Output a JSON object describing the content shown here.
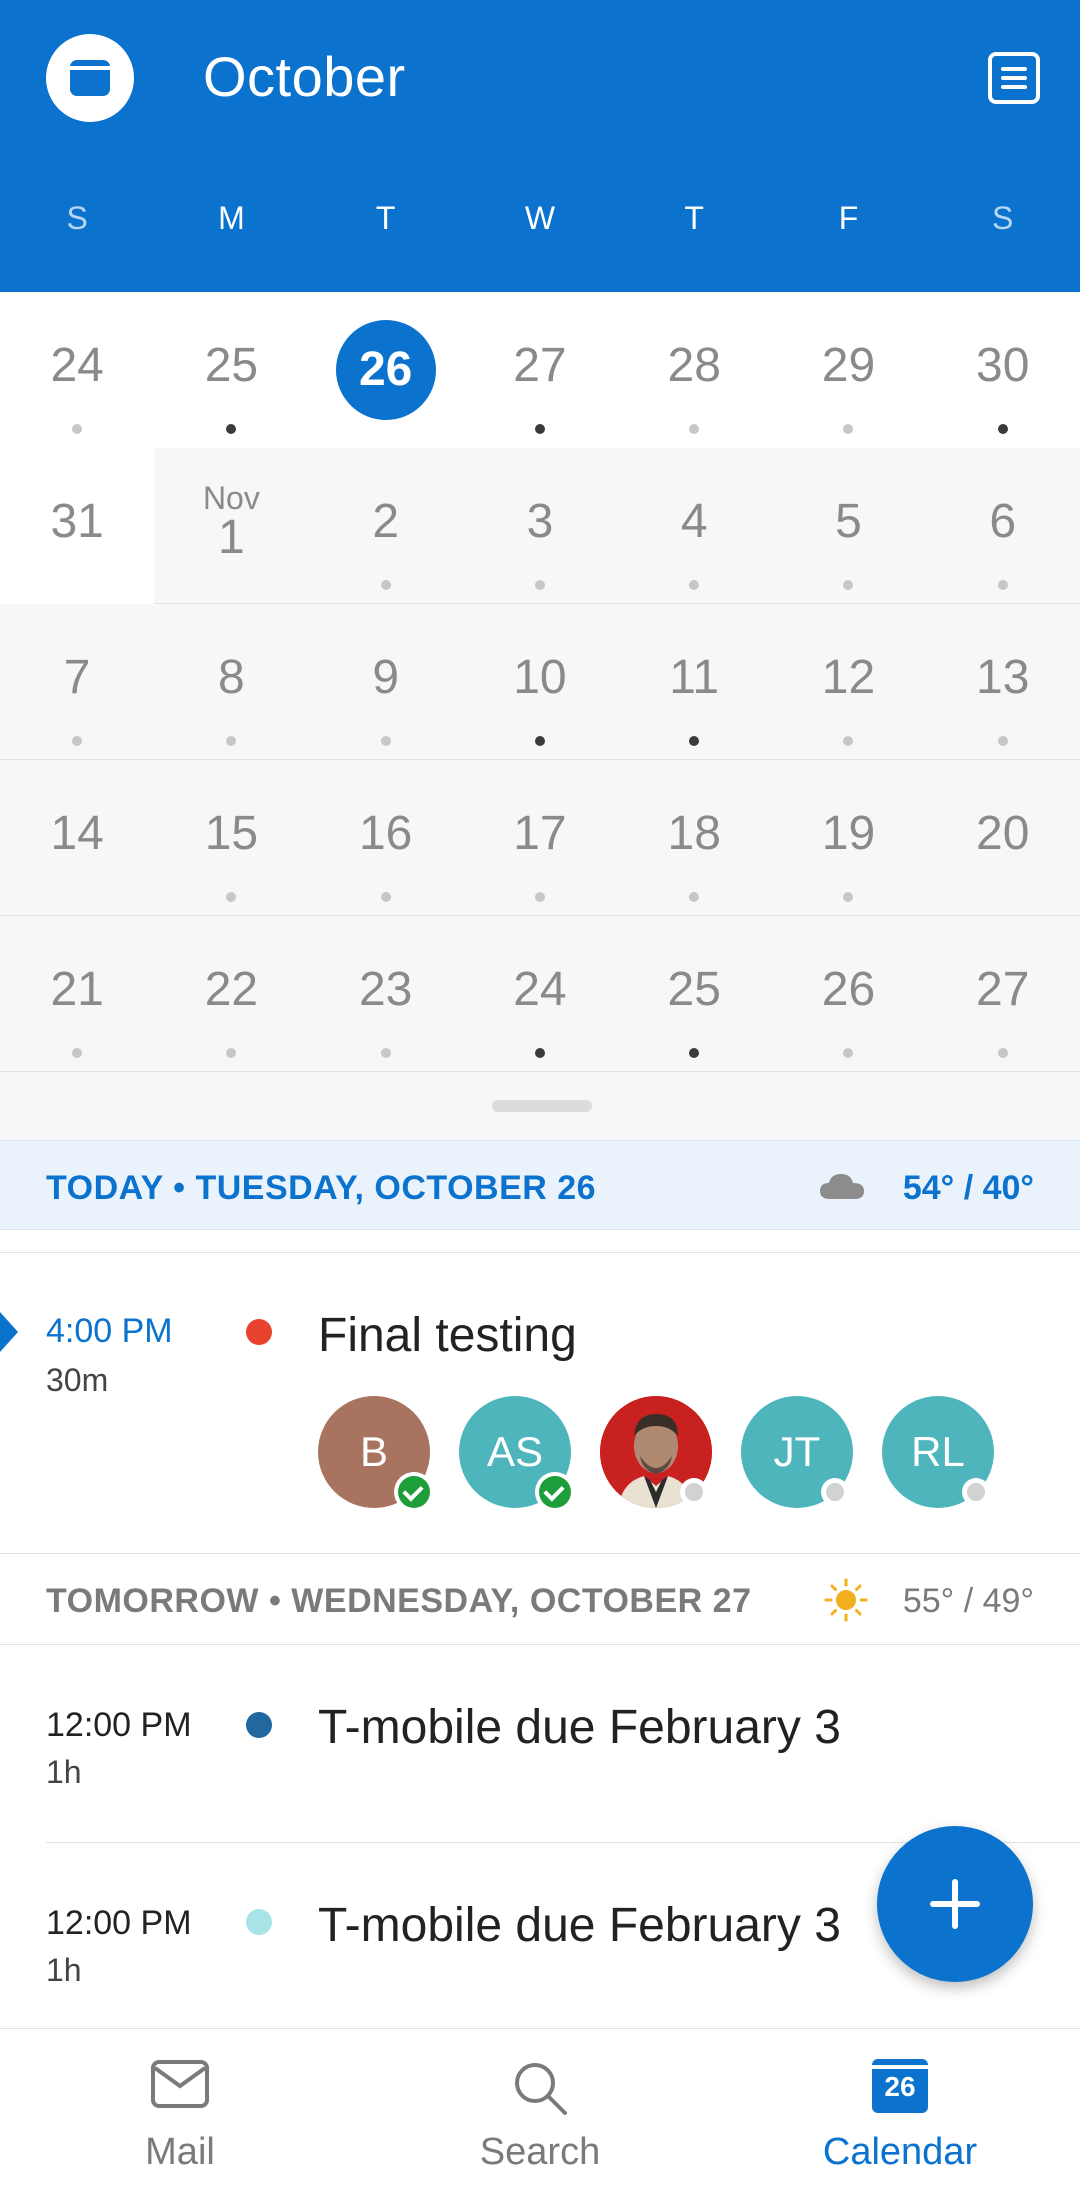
{
  "header": {
    "month": "October",
    "weekdays": [
      "S",
      "M",
      "T",
      "W",
      "T",
      "F",
      "S"
    ],
    "accent": "#0B72CE"
  },
  "grid": {
    "weeks": [
      [
        "24",
        "25",
        "26",
        "27",
        "28",
        "29",
        "30"
      ],
      [
        "31",
        "1",
        "2",
        "3",
        "4",
        "5",
        "6"
      ],
      [
        "7",
        "8",
        "9",
        "10",
        "11",
        "12",
        "13"
      ],
      [
        "14",
        "15",
        "16",
        "17",
        "18",
        "19",
        "20"
      ],
      [
        "21",
        "22",
        "23",
        "24",
        "25",
        "26",
        "27"
      ]
    ],
    "month_marker": "Nov",
    "selected_day": "26"
  },
  "today": {
    "label": "TODAY • TUESDAY, OCTOBER 26",
    "temp": "54° / 40°",
    "weather_icon": "cloud-icon"
  },
  "events_today": [
    {
      "time": "4:00 PM",
      "duration": "30m",
      "title": "Final testing",
      "color": "#E8432E",
      "attendees": [
        {
          "initials": "B",
          "color": "#A8735F",
          "status": "accepted"
        },
        {
          "initials": "AS",
          "color": "#4EB5BD",
          "status": "accepted"
        },
        {
          "initials": "",
          "color": "#C92020",
          "status": "pending",
          "photo": true
        },
        {
          "initials": "JT",
          "color": "#4EB5BD",
          "status": "pending"
        },
        {
          "initials": "RL",
          "color": "#4EB5BD",
          "status": "pending"
        }
      ]
    }
  ],
  "tomorrow": {
    "label": "TOMORROW • WEDNESDAY, OCTOBER 27",
    "temp": "55° / 49°",
    "weather_icon": "sun-icon"
  },
  "events_tomorrow": [
    {
      "time": "12:00 PM",
      "duration": "1h",
      "title": "T-mobile due February 3",
      "color": "#22689E"
    },
    {
      "time": "12:00 PM",
      "duration": "1h",
      "title": "T-mobile due February 3",
      "color": "#A8E3E8"
    }
  ],
  "bottom_nav": {
    "mail": "Mail",
    "search": "Search",
    "calendar": "Calendar",
    "calendar_badge": "26"
  }
}
